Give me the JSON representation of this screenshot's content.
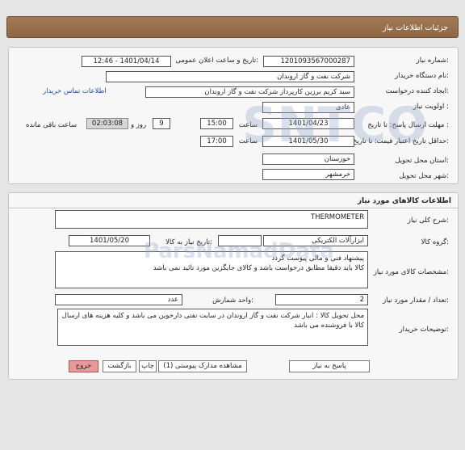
{
  "header": {
    "title": "جزئیات اطلاعات نیاز"
  },
  "need_info": {
    "need_number_label": "شماره نیاز:",
    "need_number": "1201093567000287",
    "announce_label": "تاریخ و ساعت اعلان عمومی:",
    "announce_value": "1401/04/14 - 12:46",
    "buyer_org_label": "نام دستگاه خریدار:",
    "buyer_org": "شرکت نفت و گاز اروندان",
    "requester_label": "ایجاد کننده درخواست:",
    "requester": "سید کریم برزین کارپرداز شرکت نفت و گاز اروندان",
    "contact_link": "اطلاعات تماس خریدار",
    "priority_label": "اولویت نیاز :",
    "priority": "عادی",
    "deadline_label": "مهلت ارسال پاسخ: تا تاریخ :",
    "deadline_date": "1401/04/23",
    "time_label": "ساعت",
    "deadline_time": "15:00",
    "days": "9",
    "day_and_label": "روز و",
    "remaining_time": "02:03:08",
    "remaining_label": "ساعت باقی مانده",
    "validity_label": "حداقل تاریخ اعتبار قیمت:",
    "validity_to_label": "تا تاریخ :",
    "validity_date": "1401/05/30",
    "validity_time_label": "ساعت",
    "validity_time": "17:00",
    "province_label": "استان محل تحویل:",
    "province": "خوزستان",
    "city_label": "شهر محل تحویل:",
    "city": "خرمشهر"
  },
  "goods": {
    "section_title": "اطلاعات کالاهای مورد نیاز",
    "summary_label": "شرح کلی نیاز:",
    "summary": "THERMOMETER",
    "group_label": "گروه کالا:",
    "group": "ابزارآلات الکتریکی",
    "need_date_label": "تاریخ نیاز به کالا:",
    "need_date": "1401/05/20",
    "specs_label": "مشخصات کالای مورد نیاز:",
    "specs_line1": "پیشنهاد فنی و مالی پیوست گردد",
    "specs_line2": "کالا باید دقیقا مطابق درخواست باشد و کالای جایگزین مورد تائید نمی باشد",
    "qty_label": "تعداد / مقدار مورد نیاز:",
    "qty": "2",
    "unit_label": "واحد شمارش:",
    "unit": "عدد",
    "buyer_notes_label": "توضیحات خریدار:",
    "buyer_notes": "محل تحویل کالا : انبار شرکت نفت و گاز اروندان در سایت نفتی دارخوین می باشد و کلیه هزینه های ارسال کالا با فروشنده می باشد"
  },
  "actions": {
    "reply": "پاسخ به نیاز",
    "attachments": "مشاهده مدارک پیوستی (1)",
    "print": "چاپ",
    "back": "بازگشت",
    "exit": "خروج"
  }
}
